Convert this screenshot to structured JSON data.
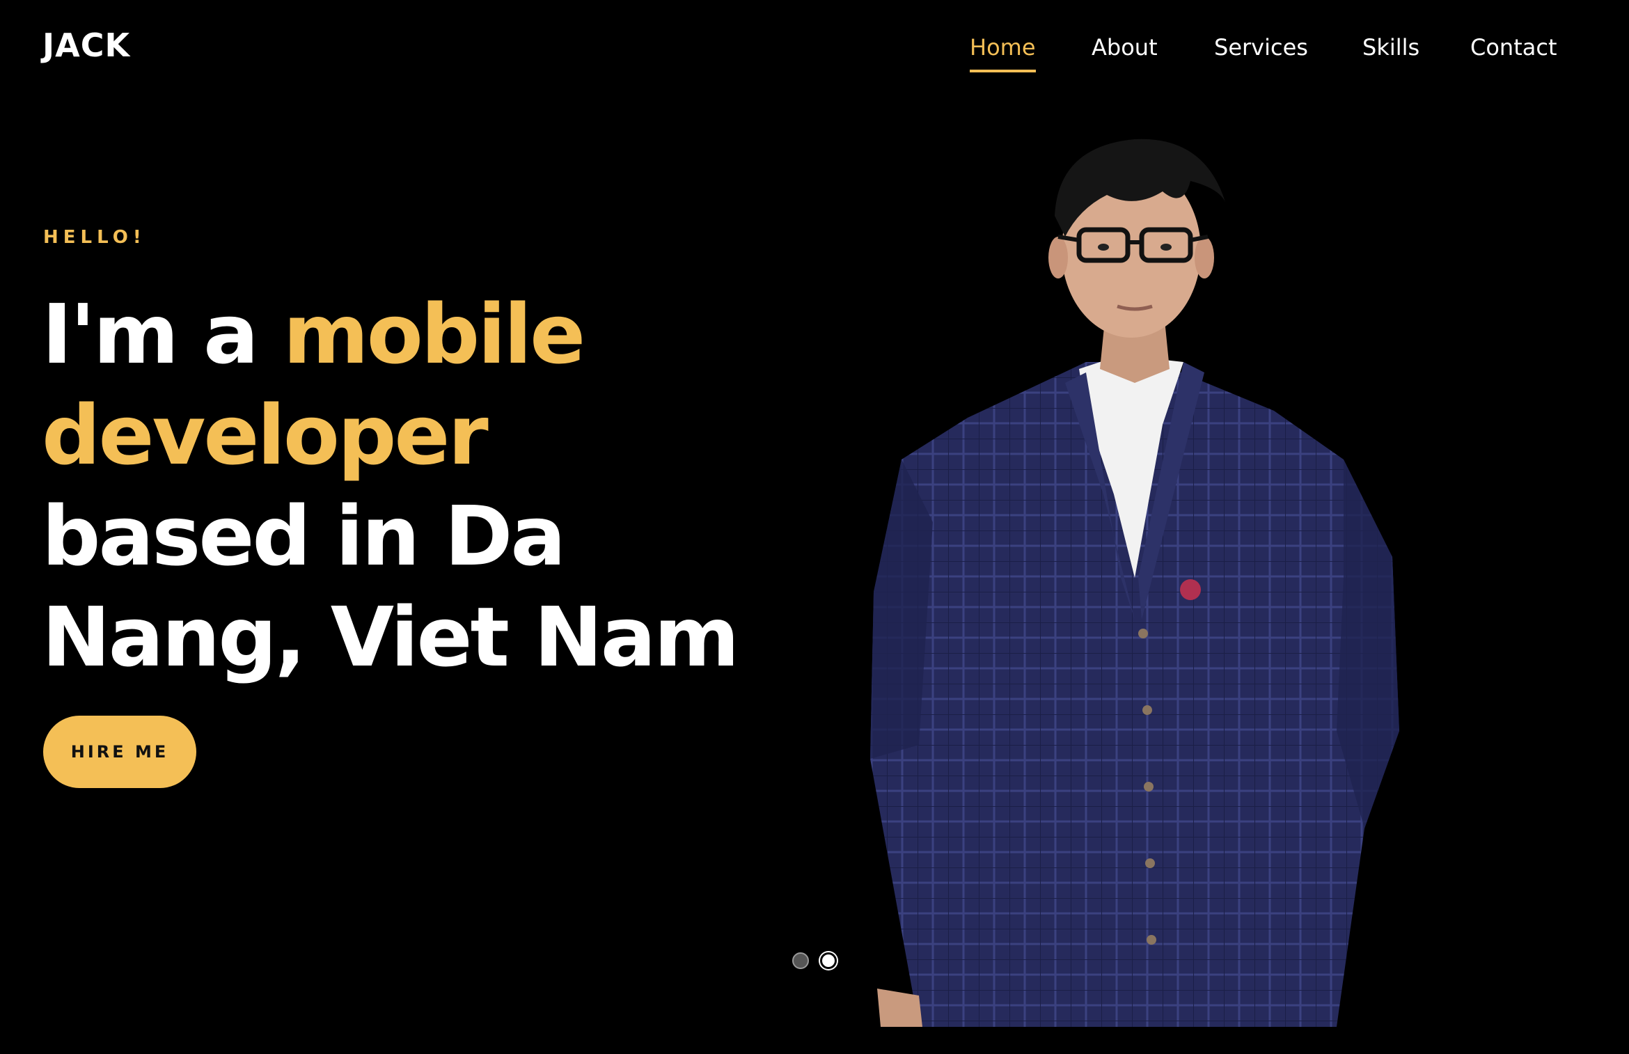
{
  "brand": {
    "logo": "JACK"
  },
  "nav": {
    "items": [
      {
        "label": "Home",
        "active": true
      },
      {
        "label": "About",
        "active": false
      },
      {
        "label": "Services",
        "active": false
      },
      {
        "label": "Skills",
        "active": false
      },
      {
        "label": "Contact",
        "active": false
      }
    ]
  },
  "hero": {
    "eyebrow": "HELLO!",
    "line1_prefix": "I'm a ",
    "line1_highlight": "mobile",
    "line2_highlight": "developer",
    "line3": "based in Da",
    "line4": "Nang, Viet Nam",
    "cta_label": "HIRE ME"
  },
  "carousel": {
    "slide_count": 2,
    "active_slide": 2
  },
  "colors": {
    "background": "#000000",
    "accent": "#f4bf56",
    "text": "#ffffff"
  }
}
